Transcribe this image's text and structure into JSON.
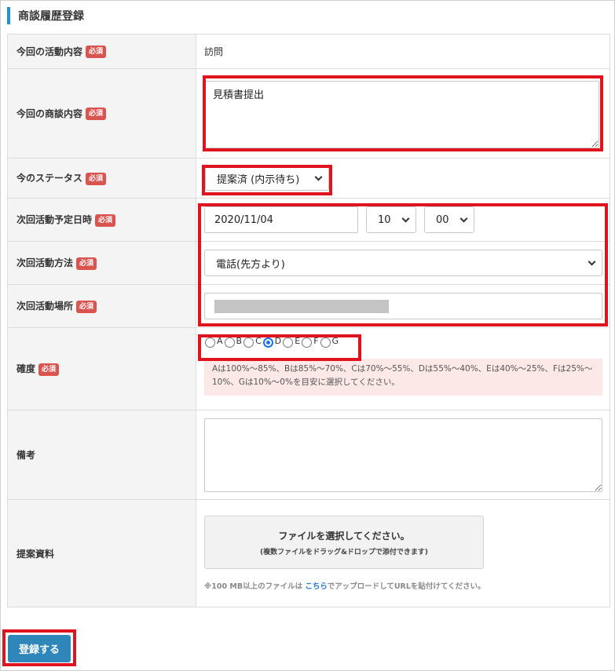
{
  "header": {
    "title": "商談履歴登録"
  },
  "required_badge": "必須",
  "fields": {
    "activity": {
      "label": "今回の活動内容",
      "value": "訪問"
    },
    "business": {
      "label": "今回の商談内容",
      "value": "見積書提出"
    },
    "status": {
      "label": "今のステータス",
      "value": "提案済 (内示待ち)"
    },
    "next_datetime": {
      "label": "次回活動予定日時",
      "date": "2020/11/04",
      "hour": "10",
      "minute": "00"
    },
    "next_method": {
      "label": "次回活動方法",
      "value": "電話(先方より)"
    },
    "next_place": {
      "label": "次回活動場所"
    },
    "certainty": {
      "label": "確度",
      "options": [
        "A",
        "B",
        "C",
        "D",
        "E",
        "F",
        "G"
      ],
      "selected": "D",
      "notice_line1": "Aは100%～85%、Bは85%～70%、Cは70%～55%、Dは55%～40%、Eは40%～25%、Fは25%～",
      "notice_line2": "10%、Gは10%～0%を目安に選択してください。"
    },
    "remarks": {
      "label": "備考",
      "value": ""
    },
    "materials": {
      "label": "提案資料",
      "upload_main": "ファイルを選択してください。",
      "upload_sub": "(複数ファイルをドラッグ&ドロップで添付できます)",
      "note_before": "※100 MB以上のファイルは ",
      "note_link": "こちら",
      "note_after": "でアップロードしてURLを貼付けてください。"
    }
  },
  "submit_label": "登録する",
  "colors": {
    "accent": "#2196c9",
    "badge": "#d9534f",
    "highlight": "#e0141e",
    "submit": "#2f86b8"
  }
}
